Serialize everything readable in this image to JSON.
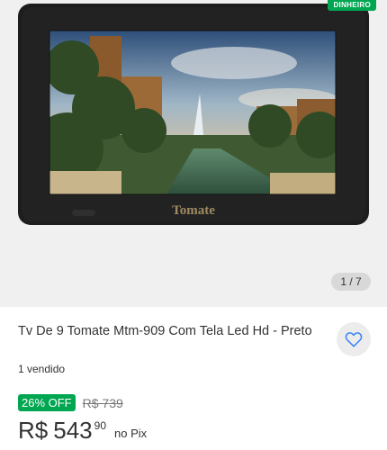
{
  "gallery": {
    "brand_text": "Tomate",
    "badge": "DINHEIRO",
    "counter": "1 / 7"
  },
  "product": {
    "title": "Tv De 9  Tomate Mtm-909 Com Tela Led Hd - Preto",
    "sold": "1 vendido",
    "discount": "26% OFF",
    "old_price": "R$ 739",
    "currency": "R$",
    "price_whole": "543",
    "price_cents": "90",
    "price_suffix": "no Pix"
  },
  "colors": {
    "accent_green": "#00a650",
    "favorite_icon": "#3483fa"
  }
}
